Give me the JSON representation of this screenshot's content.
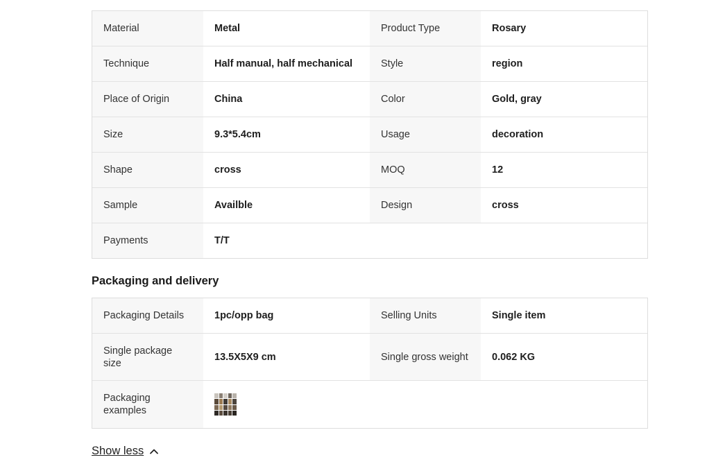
{
  "attributes": {
    "rows": [
      {
        "k1": "Material",
        "v1": "Metal",
        "k2": "Product Type",
        "v2": "Rosary"
      },
      {
        "k1": "Technique",
        "v1": "Half manual, half mechanical",
        "k2": "Style",
        "v2": "region"
      },
      {
        "k1": "Place of Origin",
        "v1": "China",
        "k2": "Color",
        "v2": "Gold, gray"
      },
      {
        "k1": "Size",
        "v1": "9.3*5.4cm",
        "k2": "Usage",
        "v2": "decoration"
      },
      {
        "k1": "Shape",
        "v1": "cross",
        "k2": "MOQ",
        "v2": "12"
      },
      {
        "k1": "Sample",
        "v1": "Availble",
        "k2": "Design",
        "v2": "cross"
      },
      {
        "k1": "Payments",
        "v1": "T/T"
      }
    ]
  },
  "packaging": {
    "title": "Packaging and delivery",
    "rows": [
      {
        "k1": "Packaging Details",
        "v1": "1pc/opp bag",
        "k2": "Selling Units",
        "v2": "Single item"
      },
      {
        "k1": "Single package size",
        "v1": "13.5X5X9 cm",
        "k2": "Single gross weight",
        "v2": "0.062 KG"
      },
      {
        "k1": "Packaging examples",
        "image_icon": "packaging-thumbnail"
      }
    ]
  },
  "footer": {
    "show_less_label": "Show less",
    "icon": "chevron-up-icon"
  },
  "colors": {
    "label_bg": "#f7f7f7",
    "border": "#dddddd",
    "text": "#222222"
  }
}
